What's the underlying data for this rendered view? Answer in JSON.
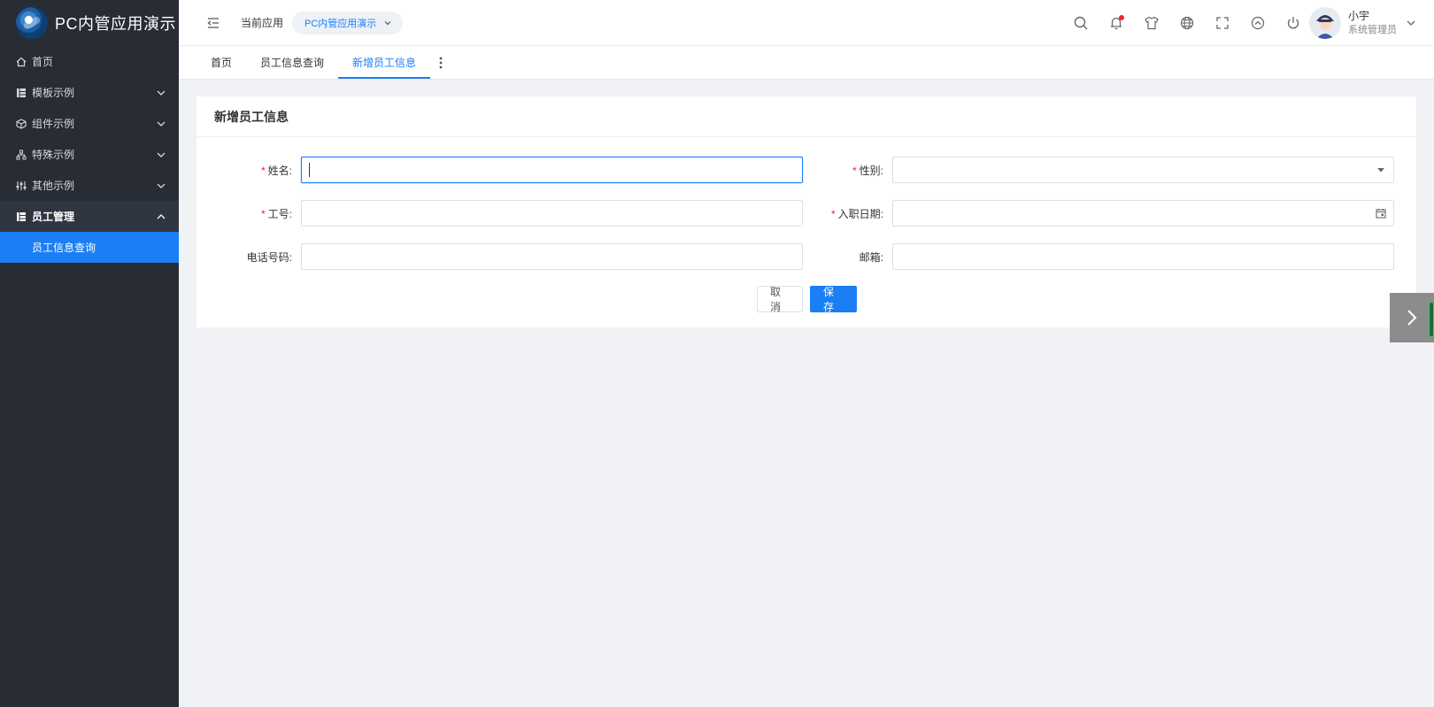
{
  "app": {
    "title": "PC内管应用演示",
    "current_app_label": "当前应用",
    "current_app_value": "PC内管应用演示"
  },
  "sidebar": {
    "items": [
      {
        "label": "首页",
        "icon": "home-icon",
        "expandable": false
      },
      {
        "label": "模板示例",
        "icon": "table-icon",
        "expandable": true
      },
      {
        "label": "组件示例",
        "icon": "cube-icon",
        "expandable": true
      },
      {
        "label": "特殊示例",
        "icon": "tree-icon",
        "expandable": true
      },
      {
        "label": "其他示例",
        "icon": "sliders-icon",
        "expandable": true
      },
      {
        "label": "员工管理",
        "icon": "table-icon",
        "expandable": true,
        "open": true
      }
    ],
    "sub_item": {
      "label": "员工信息查询",
      "active": true
    }
  },
  "header": {
    "icons": [
      "search-icon",
      "bell-icon",
      "shirt-icon",
      "globe-icon",
      "fullscreen-icon",
      "up-circle-icon",
      "power-icon"
    ],
    "notification_dot": true,
    "user": {
      "name": "小宇",
      "role": "系统管理员"
    }
  },
  "tabs": [
    {
      "label": "首页",
      "active": false
    },
    {
      "label": "员工信息查询",
      "active": false
    },
    {
      "label": "新增员工信息",
      "active": true
    }
  ],
  "form": {
    "title": "新增员工信息",
    "fields": {
      "name": {
        "label": "姓名:",
        "required": true,
        "value": ""
      },
      "gender": {
        "label": "性别:",
        "required": true,
        "value": ""
      },
      "employee_id": {
        "label": "工号:",
        "required": true,
        "value": ""
      },
      "hire_date": {
        "label": "入职日期:",
        "required": true,
        "value": ""
      },
      "phone": {
        "label": "电话号码:",
        "required": false,
        "value": ""
      },
      "email": {
        "label": "邮箱:",
        "required": false,
        "value": ""
      }
    },
    "cancel_label": "取消",
    "save_label": "保存"
  },
  "colors": {
    "sidebar_bg": "#272c35",
    "accent": "#1a7ef5",
    "required": "#f5222d"
  }
}
